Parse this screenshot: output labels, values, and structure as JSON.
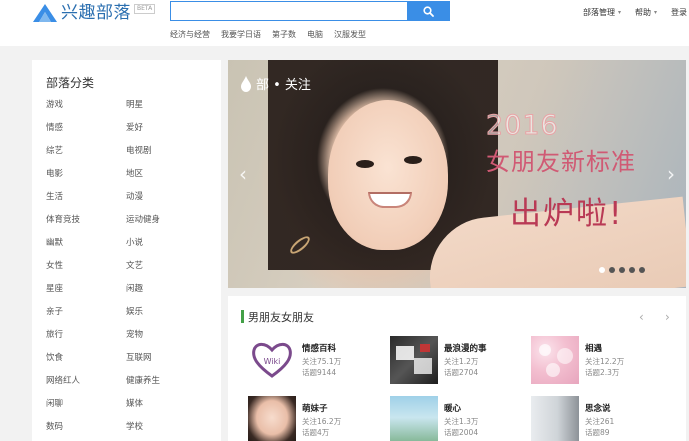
{
  "header": {
    "logo_text": "兴趣部落",
    "logo_badge": "BETA",
    "search": {
      "value": "",
      "placeholder": ""
    },
    "hot_links": [
      "经济与经营",
      "我要学日语",
      "第子数",
      "电脑",
      "汉服发型"
    ],
    "nav": [
      {
        "label": "部落管理",
        "has_caret": true
      },
      {
        "label": "帮助",
        "has_caret": true
      },
      {
        "label": "登录",
        "has_caret": false
      }
    ]
  },
  "sidebar": {
    "title": "部落分类",
    "categories": [
      "游戏",
      "明星",
      "情感",
      "爱好",
      "综艺",
      "电视剧",
      "电影",
      "地区",
      "生活",
      "动漫",
      "体育竞技",
      "运动健身",
      "幽默",
      "小说",
      "女性",
      "文艺",
      "星座",
      "闲趣",
      "亲子",
      "娱乐",
      "旅行",
      "宠物",
      "饮食",
      "互联网",
      "网络红人",
      "健康养生",
      "闲聊",
      "媒体",
      "数码",
      "学校"
    ]
  },
  "banner": {
    "tag": "部 • 关注",
    "year": "2016",
    "line1": "女朋友新标准",
    "line2": "出炉啦!",
    "slide_count": 5,
    "active_slide": 0
  },
  "section": {
    "title": "男朋友女朋友",
    "groups": [
      {
        "name": "情感百科",
        "follow": "关注75.1万",
        "topics": "话题9144",
        "thumb": "heart-logo"
      },
      {
        "name": "最浪漫的事",
        "follow": "关注1.2万",
        "topics": "话题2704",
        "thumb": "romance-text"
      },
      {
        "name": "相遇",
        "follow": "关注12.2万",
        "topics": "话题2.3万",
        "thumb": "blossom"
      },
      {
        "name": "萌妹子",
        "follow": "关注16.2万",
        "topics": "话题4万",
        "thumb": "girl-portrait"
      },
      {
        "name": "暖心",
        "follow": "关注1.3万",
        "topics": "话题2004",
        "thumb": "anime-scene"
      },
      {
        "name": "思念说",
        "follow": "关注261",
        "topics": "话题89",
        "thumb": "window-girl"
      }
    ]
  },
  "colors": {
    "accent": "#3a8ee6",
    "logo": "#2b6fb0",
    "section_marker": "#43a047",
    "banner_text": "#d05a74"
  }
}
